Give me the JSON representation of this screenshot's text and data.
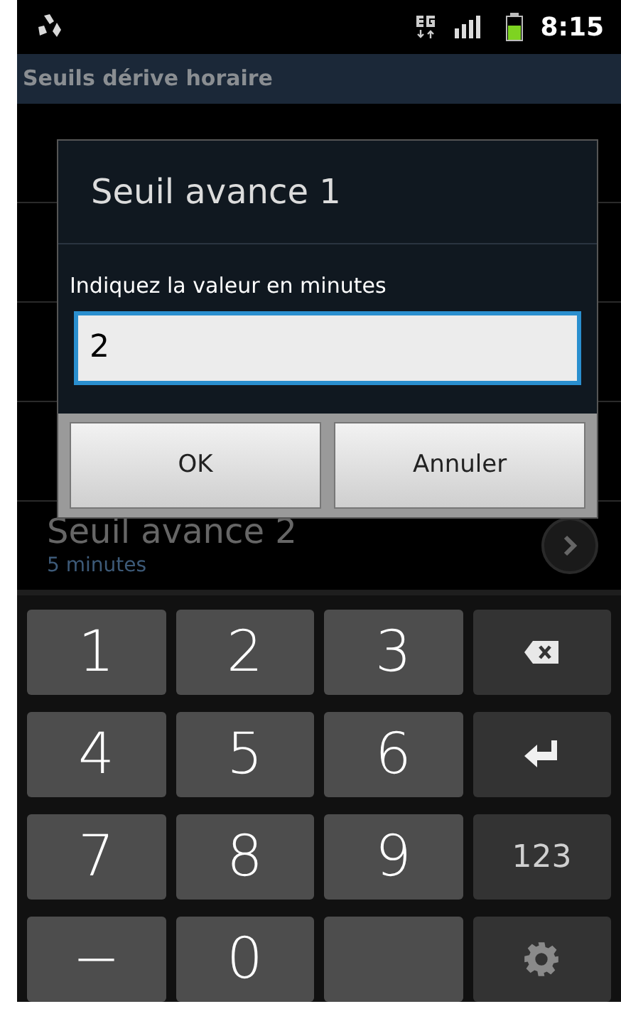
{
  "status_bar": {
    "time": "8:15"
  },
  "title_bar": {
    "title": "Seuils dérive horaire"
  },
  "list": {
    "items": [
      {
        "title": "Seuil avance 2",
        "subtitle": "5 minutes"
      }
    ]
  },
  "dialog": {
    "title": "Seuil avance 1",
    "prompt": "Indiquez la valeur en minutes",
    "value": "2",
    "buttons": [
      "OK",
      "Annuler"
    ]
  },
  "keyboard": {
    "keys": [
      {
        "kind": "digit",
        "label": "1"
      },
      {
        "kind": "digit",
        "label": "2"
      },
      {
        "kind": "digit",
        "label": "3"
      },
      {
        "kind": "backspace"
      },
      {
        "kind": "digit",
        "label": "4"
      },
      {
        "kind": "digit",
        "label": "5"
      },
      {
        "kind": "digit",
        "label": "6"
      },
      {
        "kind": "enter"
      },
      {
        "kind": "digit",
        "label": "7"
      },
      {
        "kind": "digit",
        "label": "8"
      },
      {
        "kind": "digit",
        "label": "9"
      },
      {
        "kind": "function",
        "label": "123"
      },
      {
        "kind": "digit",
        "label": "−"
      },
      {
        "kind": "digit",
        "label": "0"
      },
      {
        "kind": "blank"
      },
      {
        "kind": "settings"
      }
    ]
  }
}
